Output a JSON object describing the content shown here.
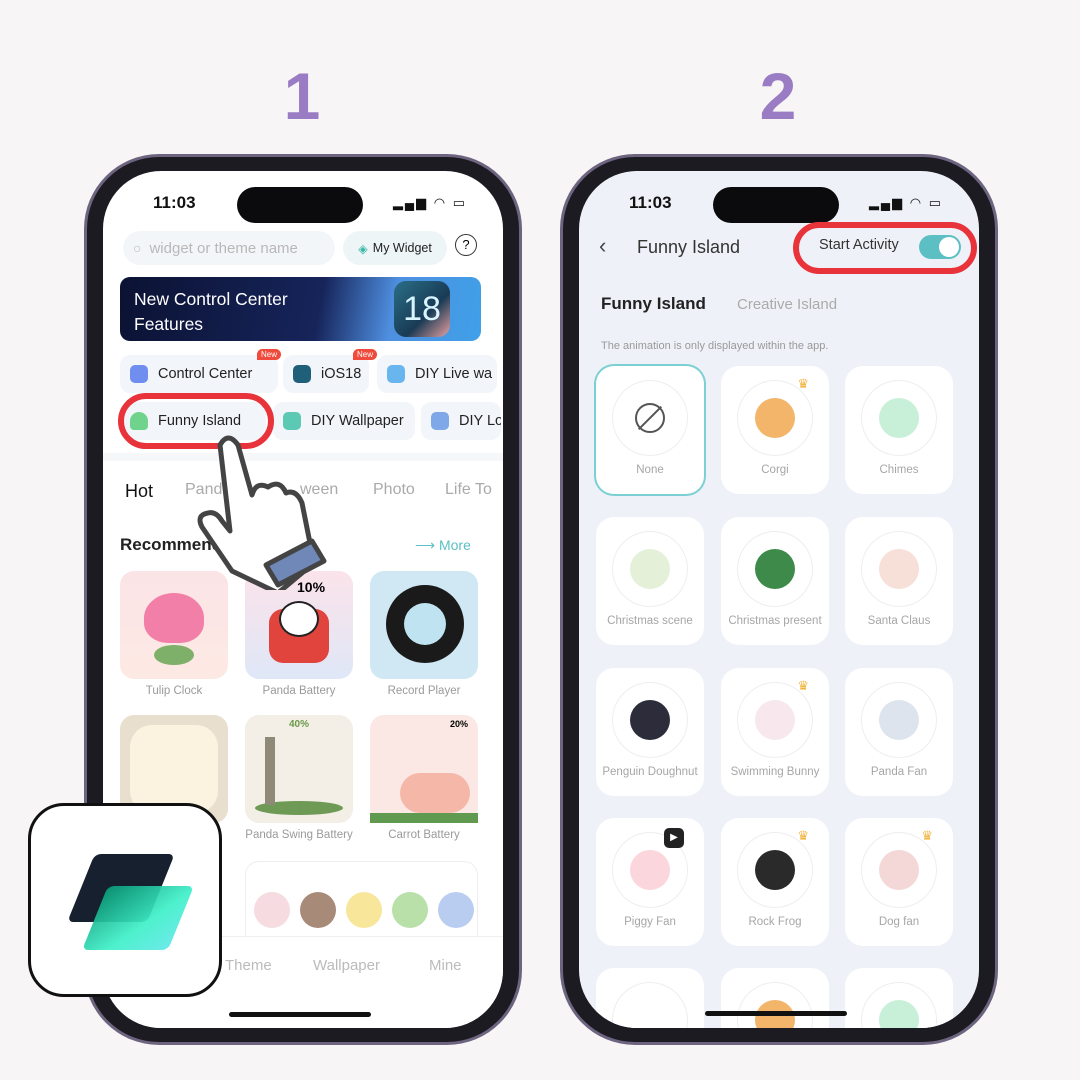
{
  "steps": [
    "1",
    "2"
  ],
  "status": {
    "time": "11:03",
    "icons": "signal-wifi-battery"
  },
  "phone1": {
    "search_placeholder": "widget or theme name",
    "my_widget": "My Widget",
    "banner": {
      "line1": "New Control Center",
      "line2": "Features",
      "badge": "18"
    },
    "shortcuts": [
      {
        "label": "Control Center",
        "new": "New"
      },
      {
        "label": "iOS18",
        "new": "New"
      },
      {
        "label": "DIY Live wa"
      },
      {
        "label": "Funny Island"
      },
      {
        "label": "DIY Wallpaper"
      },
      {
        "label": "DIY Lo"
      }
    ],
    "tabs": [
      "Hot",
      "Pand",
      "ween",
      "Photo",
      "Life To"
    ],
    "section_title": "Recommend",
    "more": "More",
    "widgets": [
      {
        "label": "Tulip Clock"
      },
      {
        "label": "Panda Battery",
        "text": "10%"
      },
      {
        "label": "Record Player"
      },
      {
        "label": ""
      },
      {
        "label": "Panda Swing Battery",
        "text": "40%"
      },
      {
        "label": "Carrot Battery",
        "text": "20%"
      }
    ],
    "bottom_nav": [
      "Theme",
      "Wallpaper",
      "Mine"
    ]
  },
  "phone2": {
    "title": "Funny Island",
    "start_activity": "Start Activity",
    "toggle_on": true,
    "tabs": [
      "Funny Island",
      "Creative Island"
    ],
    "note": "The animation is only displayed within the app.",
    "items": [
      {
        "label": "None",
        "selected": true
      },
      {
        "label": "Corgi",
        "badge": "crown"
      },
      {
        "label": "Chimes"
      },
      {
        "label": "Christmas scene"
      },
      {
        "label": "Christmas present"
      },
      {
        "label": "Santa Claus"
      },
      {
        "label": "Penguin Doughnut"
      },
      {
        "label": "Swimming Bunny",
        "badge": "crown"
      },
      {
        "label": "Panda Fan"
      },
      {
        "label": "Piggy Fan",
        "badge": "play"
      },
      {
        "label": "Rock Frog",
        "badge": "crown"
      },
      {
        "label": "Dog fan",
        "badge": "crown"
      }
    ]
  },
  "colors": {
    "accent": "#5bbfc4",
    "highlight": "#e8333a",
    "step": "#9a7cc4"
  }
}
